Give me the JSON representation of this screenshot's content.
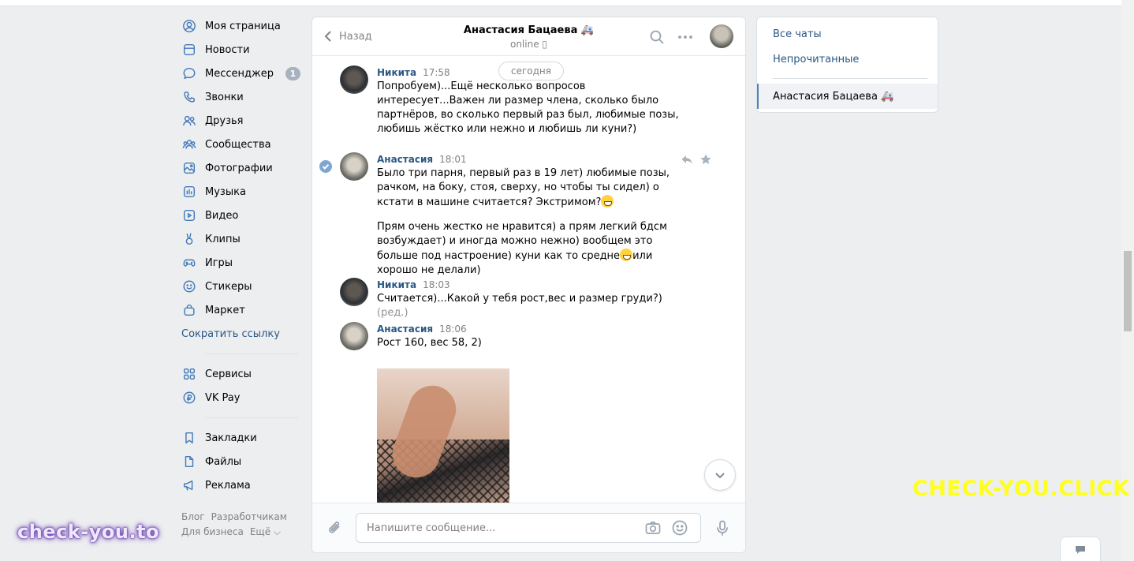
{
  "nav": {
    "items": [
      {
        "label": "Моя страница",
        "icon": "user-circle-icon"
      },
      {
        "label": "Новости",
        "icon": "news-icon"
      },
      {
        "label": "Мессенджер",
        "icon": "message-icon",
        "badge": "1"
      },
      {
        "label": "Звонки",
        "icon": "phone-icon"
      },
      {
        "label": "Друзья",
        "icon": "friends-icon"
      },
      {
        "label": "Сообщества",
        "icon": "communities-icon"
      },
      {
        "label": "Фотографии",
        "icon": "photo-icon"
      },
      {
        "label": "Музыка",
        "icon": "music-icon"
      },
      {
        "label": "Видео",
        "icon": "video-icon"
      },
      {
        "label": "Клипы",
        "icon": "clips-icon"
      },
      {
        "label": "Игры",
        "icon": "gamepad-icon"
      },
      {
        "label": "Стикеры",
        "icon": "smile-icon"
      },
      {
        "label": "Маркет",
        "icon": "bag-icon"
      }
    ],
    "shorten_link": "Сократить ссылку",
    "items2": [
      {
        "label": "Сервисы",
        "icon": "grid-icon"
      },
      {
        "label": "VK Pay",
        "icon": "ruble-icon"
      }
    ],
    "items3": [
      {
        "label": "Закладки",
        "icon": "bookmark-icon"
      },
      {
        "label": "Файлы",
        "icon": "file-icon"
      },
      {
        "label": "Реклама",
        "icon": "megaphone-icon"
      }
    ],
    "footer": {
      "blog": "Блог",
      "developers": "Разработчикам",
      "business": "Для бизнеса",
      "more": "Ещё ⌵"
    }
  },
  "chat": {
    "back_label": "Назад",
    "title": "Анастасия Бацаева 🚑",
    "status": "online ▯",
    "date_pill": "сегодня",
    "messages": [
      {
        "author": "Никита",
        "time": "17:58",
        "text": "Попробуем)...Ещё несколько вопросов интересует...Важен ли размер члена, сколько было партнёров, во сколько первый раз был, любимые позы, любишь жёстко или нежно и любишь ли куни?)"
      },
      {
        "author": "Анастасия",
        "time": "18:01",
        "text1a": "Было три парня, первый раз в 19 лет) любимые позы, рачком, на боку, стоя, сверху, но чтобы ты сидел) о кстати в машине считается? Экстримом?",
        "text2a": "Прям очень жестко не нравится) а прям легкий бдсм возбуждает) и иногда можно нежно) вообщем это больше под настроение) куни как то средне",
        "text2b": "или хорошо не делали)"
      },
      {
        "author": "Никита",
        "time": "18:03",
        "text": "Считается)...Какой у тебя рост,вес и размер груди?)",
        "edited": "(ред.)"
      },
      {
        "author": "Анастасия",
        "time": "18:06",
        "text": "Рост 160, вес 58, 2)"
      }
    ],
    "composer_placeholder": "Напишите сообщение..."
  },
  "right_panel": {
    "all_chats": "Все чаты",
    "unread": "Непрочитанные",
    "active_chat": "Анастасия Бацаева 🚑"
  },
  "watermarks": {
    "left": "check-you.to",
    "right": "CHECK-YOU.CLICK"
  },
  "colors": {
    "link": "#2a5885",
    "icon": "#447bba",
    "background": "#edeef0",
    "watermark_right": "#ffff1f"
  }
}
